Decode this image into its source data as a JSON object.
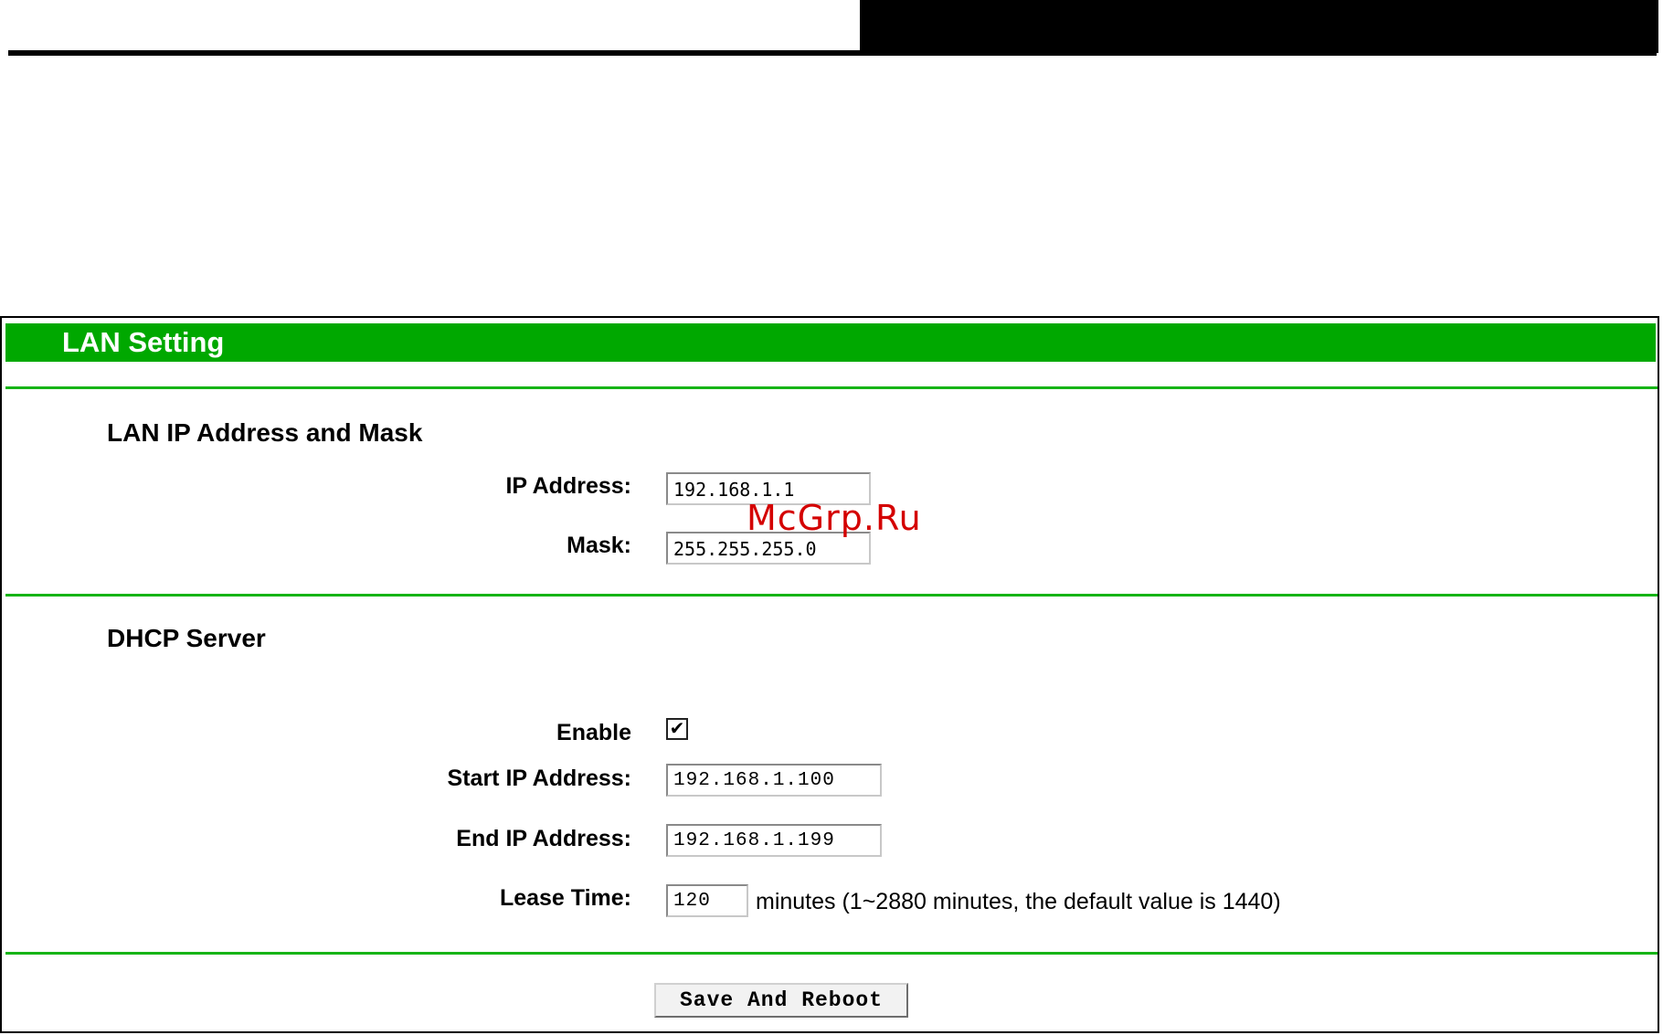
{
  "watermark": "McGrp.Ru",
  "panel": {
    "title": "LAN Setting"
  },
  "lan_section": {
    "heading": "LAN IP Address and Mask",
    "ip_label": "IP Address:",
    "ip_value": "192.168.1.1",
    "mask_label": "Mask:",
    "mask_value": "255.255.255.0"
  },
  "dhcp_section": {
    "heading": "DHCP Server",
    "enable_label": "Enable",
    "enable_checked": true,
    "check_mark": "✔",
    "start_label": "Start IP Address:",
    "start_value": "192.168.1.100",
    "end_label": "End IP Address:",
    "end_value": "192.168.1.199",
    "lease_label": "Lease Time:",
    "lease_value": "120",
    "lease_hint": "minutes (1~2880 minutes, the default value is 1440)"
  },
  "actions": {
    "save_label": "Save And Reboot"
  },
  "colors": {
    "header_bg": "#00a800",
    "divider": "#16b416",
    "watermark": "#d40000"
  }
}
